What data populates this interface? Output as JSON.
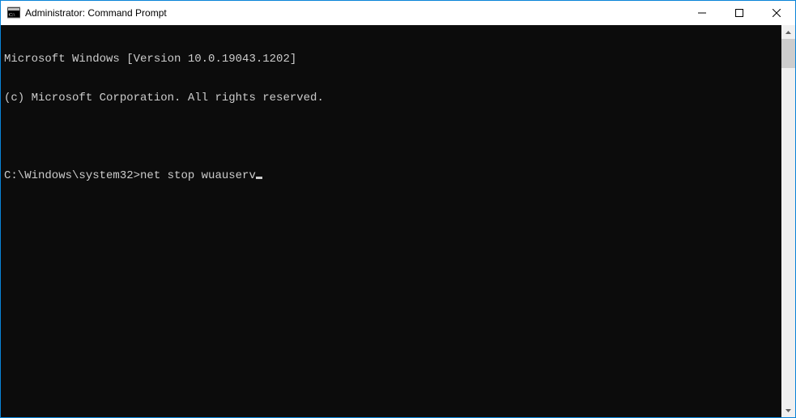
{
  "titlebar": {
    "title": "Administrator: Command Prompt"
  },
  "console": {
    "line1": "Microsoft Windows [Version 10.0.19043.1202]",
    "line2": "(c) Microsoft Corporation. All rights reserved.",
    "blank": "",
    "prompt": "C:\\Windows\\system32>",
    "command": "net stop wuauserv"
  }
}
